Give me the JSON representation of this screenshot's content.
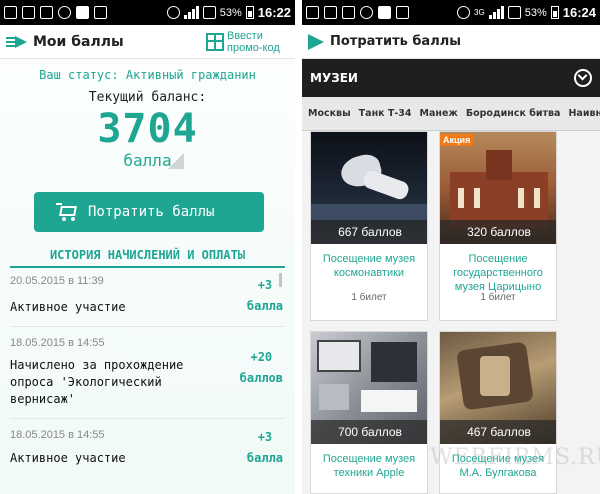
{
  "left": {
    "status_bar": {
      "battery": "53%",
      "time": "16:22"
    },
    "app_bar": {
      "title": "Мои баллы",
      "promo_label": "Ввести промо-код"
    },
    "status_text": "Ваш статус: Активный гражданин",
    "balance_label": "Текущий баланс:",
    "balance_value": "3704",
    "balance_unit": "балла",
    "spend_button_label": "Потратить баллы",
    "history_title": "ИСТОРИЯ НАЧИСЛЕНИЙ И ОПЛАТЫ",
    "history": [
      {
        "date": "20.05.2015 в 11:39",
        "description": "Активное участие",
        "points": "+3",
        "unit": "балла"
      },
      {
        "date": "18.05.2015 в 14:55",
        "description": "Начислено за прохождение опроса 'Экологический вернисаж'",
        "points": "+20",
        "unit": "баллов"
      },
      {
        "date": "18.05.2015 в 14:55",
        "description": "Активное участие",
        "points": "+3",
        "unit": "балла"
      }
    ]
  },
  "right": {
    "status_bar": {
      "battery": "53%",
      "time": "16:24",
      "network": "3G"
    },
    "app_bar": {
      "title": "Потратить баллы"
    },
    "section_label": "МУЗЕИ",
    "tabs": [
      "Москвы",
      "Танк Т-34",
      "Манеж",
      "Бородинск битва",
      "Наивн"
    ],
    "cards": [
      {
        "price": "667 баллов",
        "title": "Посещение музея космонавтики",
        "subtitle": "1 билет",
        "badge": ""
      },
      {
        "price": "320 баллов",
        "title": "Посещение государственного музея Царицыно",
        "subtitle": "1 билет",
        "badge": "Акция"
      },
      {
        "price": "700 баллов",
        "title": "Посещение музея техники Apple",
        "subtitle": "",
        "badge": ""
      },
      {
        "price": "467 баллов",
        "title": "Посещение музея М.А. Булгакова",
        "subtitle": "",
        "badge": ""
      }
    ]
  },
  "watermark": "WEBFIRMS.RU",
  "colors": {
    "accent": "#1fa693",
    "dark_bar": "#1f1f1f",
    "status_bar": "#000000"
  }
}
